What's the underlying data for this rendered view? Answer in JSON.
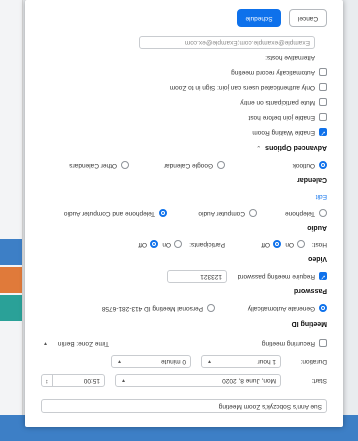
{
  "meeting": {
    "topic_value": "Sue Ann's Sobczyk's Zoom Meeting",
    "start_label": "Start:",
    "start_date": "Mon, June 8, 2020",
    "start_time": "15:00",
    "duration_label": "Duration:",
    "duration_hours": "1 hour",
    "duration_minutes": "0 minute",
    "recurring_label": "Recurring meeting",
    "timezone_label": "Time Zone: Berlin"
  },
  "meeting_id": {
    "section_label": "Meeting ID",
    "generate_label": "Generate Automatically",
    "personal_label": "Personal Meeting ID 413-281-6758"
  },
  "password": {
    "section_label": "Password",
    "require_label": "Require meeting password",
    "value": "123321"
  },
  "video": {
    "section_label": "Video",
    "host_label": "Host:",
    "participants_label": "Participants:",
    "on_label": "On",
    "off_label": "Off"
  },
  "audio": {
    "section_label": "Audio",
    "edit_label": "Edit",
    "telephone_label": "Telephone",
    "computer_label": "Computer Audio",
    "both_label": "Telephone and Computer Audio"
  },
  "calendar": {
    "section_label": "Calendar",
    "outlook_label": "Outlook",
    "google_label": "Google Calendar",
    "other_label": "Other Calendars"
  },
  "advanced": {
    "section_label": "Advanced Options",
    "waiting_room_label": "Enable Waiting Room",
    "join_before_label": "Enable join before host",
    "mute_label": "Mute participants on entry",
    "auth_label": "Only authenticated users can join: Sign in to Zoom",
    "record_label": "Automatically record meeting",
    "alt_hosts_label": "Alternative hosts:",
    "alt_hosts_value": "Example@example.com;Example@ex.com"
  },
  "actions": {
    "schedule_label": "Schedule",
    "cancel_label": "Cancel"
  },
  "colors": {
    "accent": "#0e71eb"
  }
}
